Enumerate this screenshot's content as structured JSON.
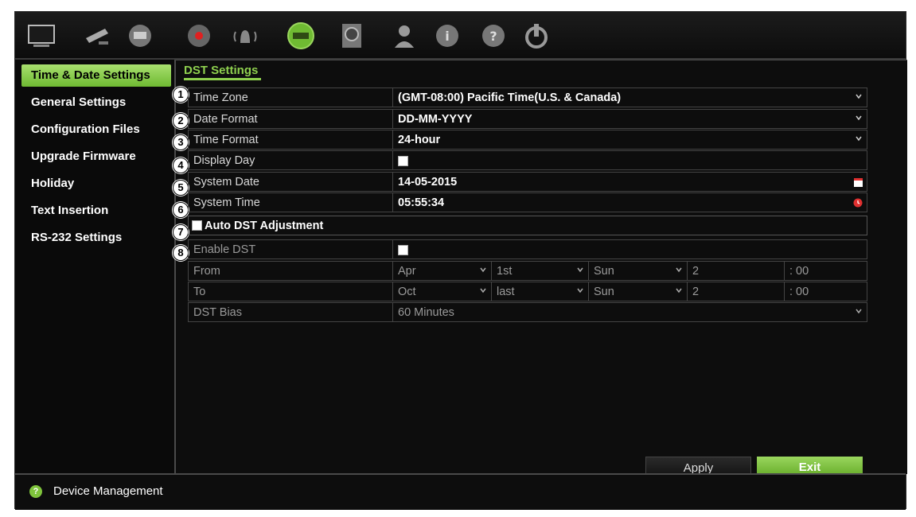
{
  "toolbar": {
    "icons": [
      "monitor-icon",
      "camera-icon",
      "network-icon",
      "record-icon",
      "alarm-icon",
      "device-management-icon",
      "hdd-icon",
      "user-icon",
      "info-icon",
      "help-icon",
      "power-icon"
    ]
  },
  "sidebar": {
    "items": [
      {
        "label": "Time & Date Settings",
        "active": true
      },
      {
        "label": "General Settings"
      },
      {
        "label": "Configuration Files"
      },
      {
        "label": "Upgrade Firmware"
      },
      {
        "label": "Holiday"
      },
      {
        "label": "Text Insertion"
      },
      {
        "label": "RS-232 Settings"
      }
    ]
  },
  "main": {
    "tab": "DST Settings",
    "markers": [
      "1",
      "2",
      "3",
      "4",
      "5",
      "6",
      "7",
      "8"
    ],
    "time_zone": {
      "label": "Time Zone",
      "value": "(GMT-08:00) Pacific Time(U.S. & Canada)"
    },
    "date_format": {
      "label": "Date Format",
      "value": "DD-MM-YYYY"
    },
    "time_format": {
      "label": "Time Format",
      "value": "24-hour"
    },
    "display_day": {
      "label": "Display Day"
    },
    "system_date": {
      "label": "System Date",
      "value": "14-05-2015"
    },
    "system_time": {
      "label": "System Time",
      "value": "05:55:34"
    },
    "auto_dst": {
      "label": "Auto DST Adjustment"
    },
    "enable_dst": {
      "label": "Enable DST"
    },
    "from": {
      "label": "From",
      "month": "Apr",
      "week": "1st",
      "day": "Sun",
      "hour": "2",
      "minute": ": 00"
    },
    "to": {
      "label": "To",
      "month": "Oct",
      "week": "last",
      "day": "Sun",
      "hour": "2",
      "minute": ": 00"
    },
    "dst_bias": {
      "label": "DST Bias",
      "value": "60 Minutes"
    }
  },
  "buttons": {
    "apply": "Apply",
    "exit": "Exit"
  },
  "status": {
    "text": "Device Management"
  },
  "colors": {
    "accent": "#8fd14f",
    "background": "#0a0a0a"
  }
}
